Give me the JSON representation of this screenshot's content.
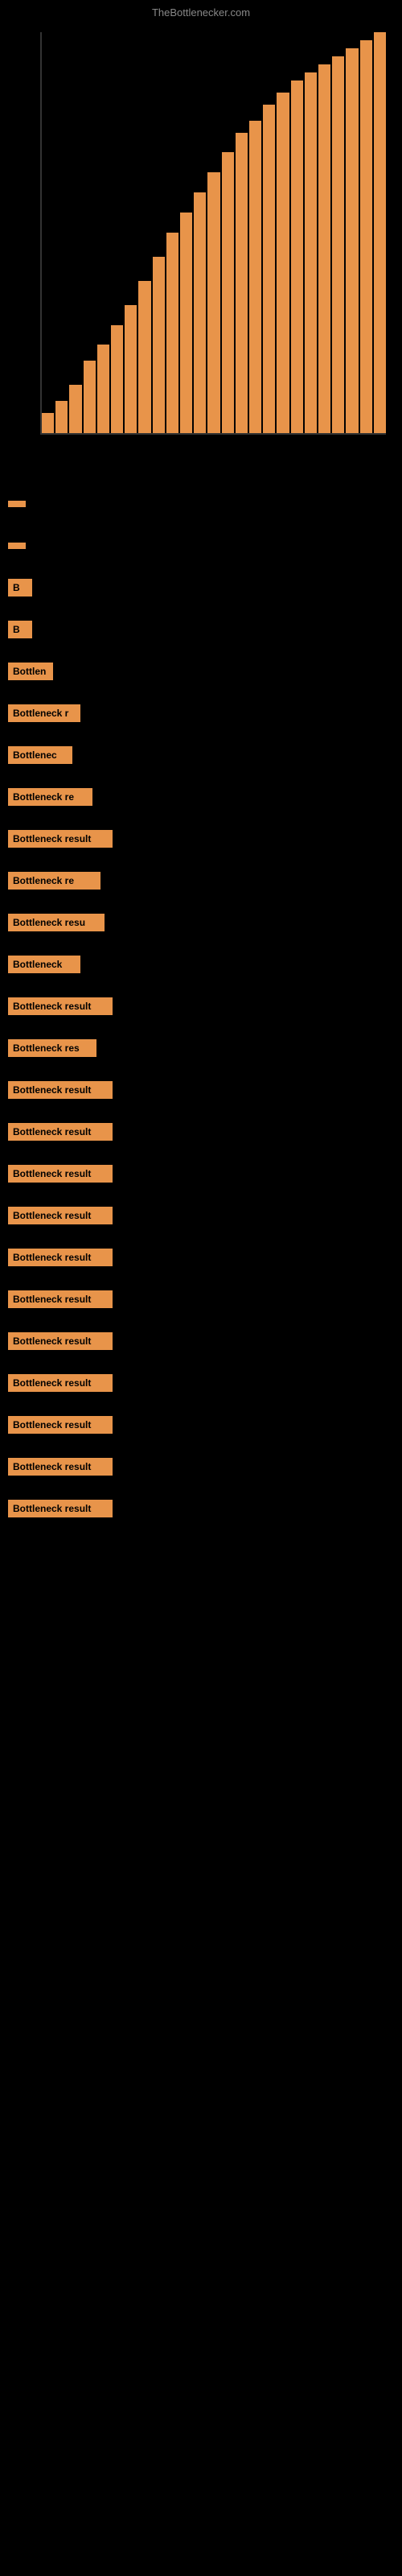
{
  "site": {
    "title": "TheBottlenecker.com"
  },
  "results": [
    {
      "id": 1,
      "label": "",
      "label_width": "label-w1"
    },
    {
      "id": 2,
      "label": "",
      "label_width": "label-w2"
    },
    {
      "id": 3,
      "label": "B",
      "label_width": "label-w3"
    },
    {
      "id": 4,
      "label": "B",
      "label_width": "label-w4"
    },
    {
      "id": 5,
      "label": "Bottlen",
      "label_width": "label-w5"
    },
    {
      "id": 6,
      "label": "Bottleneck r",
      "label_width": "label-w6"
    },
    {
      "id": 7,
      "label": "Bottlenec",
      "label_width": "label-w7"
    },
    {
      "id": 8,
      "label": "Bottleneck re",
      "label_width": "label-w8"
    },
    {
      "id": 9,
      "label": "Bottleneck result",
      "label_width": "label-w9"
    },
    {
      "id": 10,
      "label": "Bottleneck re",
      "label_width": "label-w10"
    },
    {
      "id": 11,
      "label": "Bottleneck resu",
      "label_width": "label-w11"
    },
    {
      "id": 12,
      "label": "Bottleneck",
      "label_width": "label-w12"
    },
    {
      "id": 13,
      "label": "Bottleneck result",
      "label_width": "label-w13"
    },
    {
      "id": 14,
      "label": "Bottleneck res",
      "label_width": "label-w14"
    },
    {
      "id": 15,
      "label": "Bottleneck result",
      "label_width": "label-w15"
    },
    {
      "id": 16,
      "label": "Bottleneck result",
      "label_width": "label-w16"
    },
    {
      "id": 17,
      "label": "Bottleneck result",
      "label_width": "label-w17"
    },
    {
      "id": 18,
      "label": "Bottleneck result",
      "label_width": "label-w18"
    },
    {
      "id": 19,
      "label": "Bottleneck result",
      "label_width": "label-w19"
    },
    {
      "id": 20,
      "label": "Bottleneck result",
      "label_width": "label-w20"
    },
    {
      "id": 21,
      "label": "Bottleneck result",
      "label_width": "label-w21"
    },
    {
      "id": 22,
      "label": "Bottleneck result",
      "label_width": "label-w22"
    },
    {
      "id": 23,
      "label": "Bottleneck result",
      "label_width": "label-w23"
    },
    {
      "id": 24,
      "label": "Bottleneck result",
      "label_width": "label-w24"
    },
    {
      "id": 25,
      "label": "Bottleneck result",
      "label_width": "label-w25"
    }
  ],
  "colors": {
    "accent": "#e8944a",
    "background": "#000000",
    "text_dark": "#000000",
    "text_light": "#888888"
  }
}
